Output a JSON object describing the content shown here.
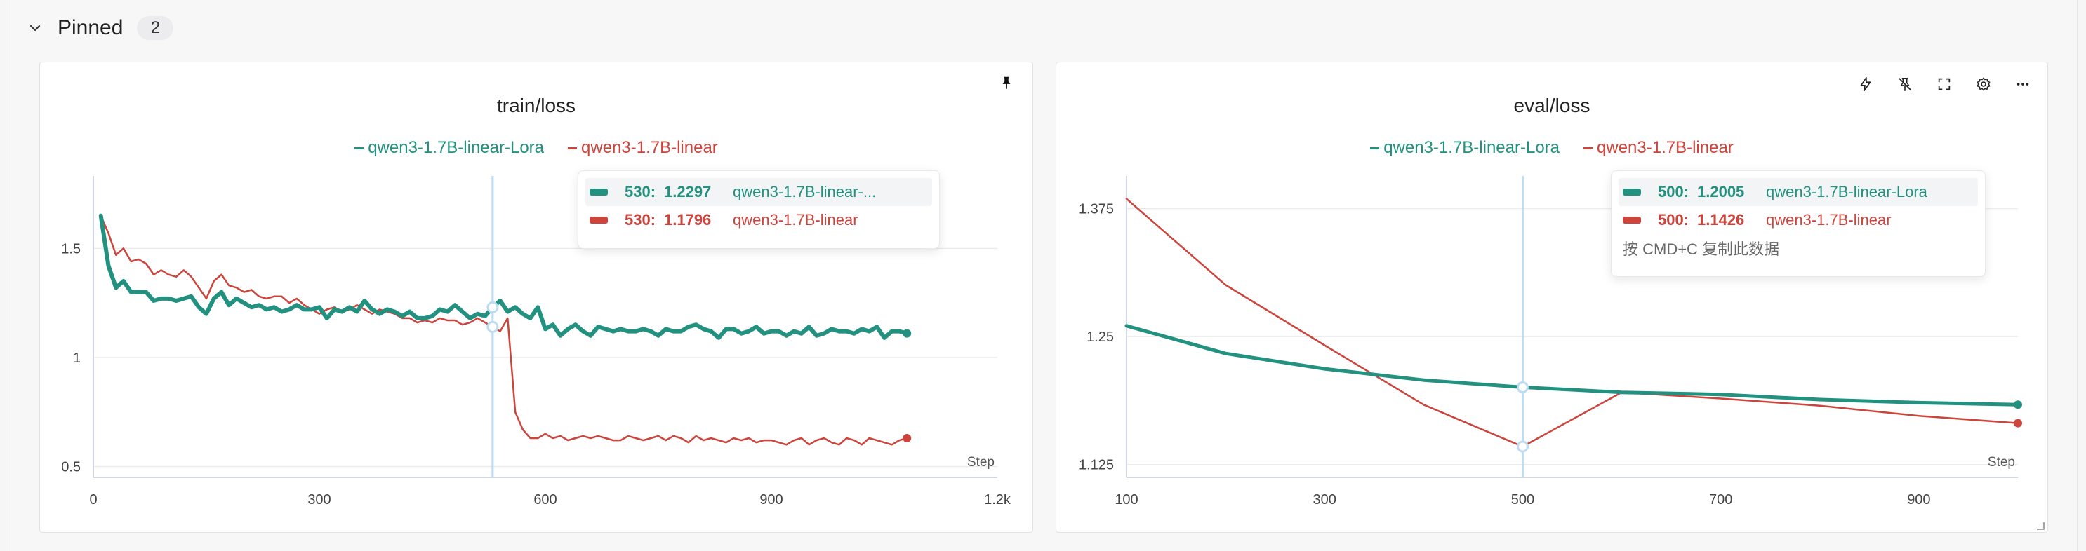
{
  "section": {
    "title": "Pinned",
    "count": "2"
  },
  "colors": {
    "series_a": "#22917f",
    "series_b": "#cc443c",
    "grid": "#ececec",
    "axis": "#cfd8e3",
    "crosshair": "#bcdcf3"
  },
  "icons": {
    "section_toggle": "chevron-down-icon",
    "train_panel": [
      "pin-icon"
    ],
    "eval_panel": [
      "lightning-icon",
      "unpin-icon",
      "fullscreen-icon",
      "gear-icon",
      "more-icon"
    ]
  },
  "train_panel": {
    "title": "train/loss",
    "legend": [
      "qwen3-1.7B-linear-Lora",
      "qwen3-1.7B-linear"
    ],
    "tooltip": {
      "rows": [
        {
          "step": "530:",
          "value": "1.2297",
          "name": "qwen3-1.7B-linear-..."
        },
        {
          "step": "530:",
          "value": "1.1796",
          "name": "qwen3-1.7B-linear"
        }
      ]
    }
  },
  "eval_panel": {
    "title": "eval/loss",
    "legend": [
      "qwen3-1.7B-linear-Lora",
      "qwen3-1.7B-linear"
    ],
    "tooltip": {
      "rows": [
        {
          "step": "500:",
          "value": "1.2005",
          "name": "qwen3-1.7B-linear-Lora"
        },
        {
          "step": "500:",
          "value": "1.1426",
          "name": "qwen3-1.7B-linear"
        }
      ],
      "hint": "按 CMD+C 复制此数据"
    }
  },
  "chart_data": [
    {
      "type": "line",
      "title": "train/loss",
      "xlabel": "Step",
      "ylabel": "",
      "xlim": [
        0,
        1200
      ],
      "ylim": [
        0.45,
        1.8
      ],
      "x_ticks": [
        0,
        300,
        600,
        900,
        1200
      ],
      "x_tick_labels": [
        "0",
        "300",
        "600",
        "900",
        "1.2k"
      ],
      "y_ticks": [
        0.5,
        1,
        1.5
      ],
      "y_tick_labels": [
        "0.5",
        "1",
        "1.5"
      ],
      "grid": true,
      "legend_position": "top-center",
      "hover_step": 530,
      "series": [
        {
          "name": "qwen3-1.7B-linear-Lora",
          "color": "#22917f",
          "width": 6,
          "x": [
            10,
            20,
            30,
            40,
            50,
            60,
            70,
            80,
            90,
            100,
            110,
            120,
            130,
            140,
            150,
            160,
            170,
            180,
            190,
            200,
            210,
            220,
            230,
            240,
            250,
            260,
            270,
            280,
            290,
            300,
            310,
            320,
            330,
            340,
            350,
            360,
            370,
            380,
            390,
            400,
            410,
            420,
            430,
            440,
            450,
            460,
            470,
            480,
            490,
            500,
            510,
            520,
            530,
            540,
            550,
            560,
            570,
            580,
            590,
            600,
            610,
            620,
            630,
            640,
            650,
            660,
            670,
            680,
            690,
            700,
            710,
            720,
            730,
            740,
            750,
            760,
            770,
            780,
            790,
            800,
            810,
            820,
            830,
            840,
            850,
            860,
            870,
            880,
            890,
            900,
            910,
            920,
            930,
            940,
            950,
            960,
            970,
            980,
            990,
            1000,
            1010,
            1020,
            1030,
            1040,
            1050,
            1060,
            1070,
            1080
          ],
          "y": [
            1.65,
            1.42,
            1.32,
            1.35,
            1.3,
            1.3,
            1.3,
            1.26,
            1.27,
            1.27,
            1.26,
            1.27,
            1.28,
            1.23,
            1.2,
            1.27,
            1.3,
            1.24,
            1.27,
            1.25,
            1.23,
            1.24,
            1.22,
            1.23,
            1.21,
            1.22,
            1.24,
            1.22,
            1.22,
            1.23,
            1.18,
            1.22,
            1.21,
            1.23,
            1.21,
            1.26,
            1.22,
            1.2,
            1.22,
            1.21,
            1.19,
            1.21,
            1.18,
            1.18,
            1.19,
            1.22,
            1.21,
            1.24,
            1.21,
            1.18,
            1.2,
            1.19,
            1.23,
            1.26,
            1.21,
            1.23,
            1.2,
            1.18,
            1.23,
            1.13,
            1.15,
            1.1,
            1.13,
            1.15,
            1.12,
            1.1,
            1.14,
            1.13,
            1.12,
            1.13,
            1.12,
            1.12,
            1.13,
            1.12,
            1.1,
            1.13,
            1.12,
            1.12,
            1.14,
            1.15,
            1.13,
            1.12,
            1.09,
            1.13,
            1.13,
            1.11,
            1.12,
            1.14,
            1.11,
            1.12,
            1.12,
            1.1,
            1.12,
            1.11,
            1.14,
            1.1,
            1.11,
            1.13,
            1.12,
            1.12,
            1.11,
            1.13,
            1.12,
            1.14,
            1.09,
            1.12,
            1.12,
            1.11
          ],
          "y_full": null
        },
        {
          "name": "qwen3-1.7B-linear",
          "color": "#cc443c",
          "width": 2.5,
          "x": [
            10,
            20,
            30,
            40,
            50,
            60,
            70,
            80,
            90,
            100,
            110,
            120,
            130,
            140,
            150,
            160,
            170,
            180,
            190,
            200,
            210,
            220,
            230,
            240,
            250,
            260,
            270,
            280,
            290,
            300,
            310,
            320,
            330,
            340,
            350,
            360,
            370,
            380,
            390,
            400,
            410,
            420,
            430,
            440,
            450,
            460,
            470,
            480,
            490,
            500,
            510,
            520,
            530,
            540,
            550,
            560,
            570,
            580,
            590,
            600,
            610,
            620,
            630,
            640,
            650,
            660,
            670,
            680,
            690,
            700,
            710,
            720,
            730,
            740,
            750,
            760,
            770,
            780,
            790,
            800,
            810,
            820,
            830,
            840,
            850,
            860,
            870,
            880,
            890,
            900,
            910,
            920,
            930,
            940,
            950,
            960,
            970,
            980,
            990,
            1000,
            1010,
            1020,
            1030,
            1040,
            1050,
            1060,
            1070,
            1080
          ],
          "y": [
            1.65,
            1.57,
            1.47,
            1.5,
            1.44,
            1.45,
            1.43,
            1.38,
            1.4,
            1.38,
            1.37,
            1.4,
            1.37,
            1.32,
            1.27,
            1.35,
            1.38,
            1.33,
            1.32,
            1.3,
            1.31,
            1.28,
            1.27,
            1.28,
            1.28,
            1.25,
            1.27,
            1.24,
            1.22,
            1.2,
            1.22,
            1.23,
            1.21,
            1.22,
            1.24,
            1.22,
            1.2,
            1.22,
            1.21,
            1.2,
            1.18,
            1.18,
            1.16,
            1.17,
            1.16,
            1.18,
            1.17,
            1.17,
            1.15,
            1.16,
            1.18,
            1.16,
            1.14,
            1.12,
            1.18,
            0.75,
            0.67,
            0.63,
            0.63,
            0.65,
            0.63,
            0.64,
            0.62,
            0.63,
            0.64,
            0.63,
            0.64,
            0.63,
            0.62,
            0.62,
            0.64,
            0.63,
            0.62,
            0.63,
            0.64,
            0.62,
            0.64,
            0.63,
            0.61,
            0.64,
            0.62,
            0.63,
            0.62,
            0.61,
            0.63,
            0.62,
            0.63,
            0.61,
            0.62,
            0.62,
            0.61,
            0.6,
            0.62,
            0.63,
            0.6,
            0.62,
            0.63,
            0.61,
            0.6,
            0.63,
            0.62,
            0.6,
            0.63,
            0.62,
            0.61,
            0.6,
            0.62,
            0.63
          ]
        }
      ]
    },
    {
      "type": "line",
      "title": "eval/loss",
      "xlabel": "Step",
      "ylabel": "",
      "xlim": [
        100,
        1000
      ],
      "ylim": [
        1.1125,
        1.4
      ],
      "x_ticks": [
        100,
        300,
        500,
        700,
        900
      ],
      "x_tick_labels": [
        "100",
        "300",
        "500",
        "700",
        "900"
      ],
      "y_ticks": [
        1.125,
        1.25,
        1.375
      ],
      "y_tick_labels": [
        "1.125",
        "1.25",
        "1.375"
      ],
      "grid": true,
      "legend_position": "top-center",
      "hover_step": 500,
      "series": [
        {
          "name": "qwen3-1.7B-linear-Lora",
          "color": "#22917f",
          "width": 5,
          "x": [
            100,
            200,
            300,
            400,
            500,
            600,
            700,
            800,
            900,
            1000
          ],
          "y": [
            1.2605,
            1.2335,
            1.2185,
            1.2075,
            1.2005,
            1.1955,
            1.1935,
            1.1885,
            1.1855,
            1.1835
          ]
        },
        {
          "name": "qwen3-1.7B-linear",
          "color": "#cc443c",
          "width": 2.5,
          "x": [
            100,
            200,
            300,
            400,
            500,
            600,
            700,
            800,
            900,
            1000
          ],
          "y": [
            1.3845,
            1.3005,
            1.2415,
            1.1835,
            1.1426,
            1.1955,
            1.1895,
            1.1825,
            1.1725,
            1.1655
          ]
        }
      ]
    }
  ]
}
